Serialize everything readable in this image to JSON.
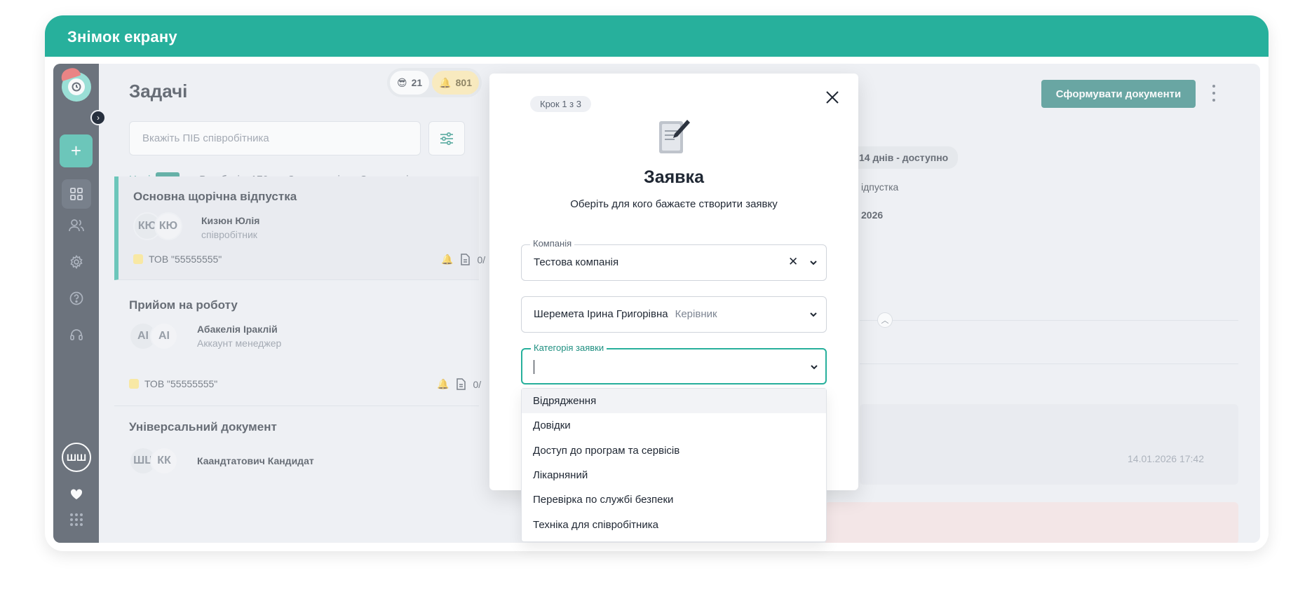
{
  "header": {
    "title": "Знімок екрану"
  },
  "sidebar": {
    "user_initials": "ШШ",
    "icons": [
      "plus-icon",
      "grid-icon",
      "users-icon",
      "gear-icon",
      "help-icon",
      "headset-icon",
      "heart-icon",
      "apps-grid-icon"
    ]
  },
  "tasks_panel": {
    "title": "Задачі",
    "counters": [
      {
        "emoji": "😎",
        "value": "21"
      },
      {
        "emoji": "🔔",
        "value": "801"
      }
    ],
    "search": {
      "placeholder": "Вкажіть ПІБ співробітника"
    },
    "tabs": [
      {
        "label": "Нові",
        "count": "340"
      },
      {
        "label": "В роботі",
        "count": "170"
      },
      {
        "label": "Завершені"
      },
      {
        "label": "Скасовані"
      }
    ],
    "tasks": [
      {
        "title": "Основна щорічна відпустка",
        "avatars": [
          "КЮ",
          "КЮ"
        ],
        "name": "Кизюн Юлія",
        "role": "співробітник",
        "company": "ТОВ \"55555555\"",
        "docs": "0/"
      },
      {
        "title": "Прийом на роботу",
        "avatars": [
          "АІ",
          "АІ"
        ],
        "name": "Абакелія Іраклій",
        "role": "Аккаунт менеджер",
        "company": "ТОВ \"55555555\"",
        "docs": "0/"
      },
      {
        "title": "Універсальний документ",
        "avatars": [
          "ШЦ",
          "КК"
        ],
        "name": "Каандтатович Кандидат"
      }
    ]
  },
  "right_panel": {
    "generate_button": "Сформувати документи",
    "chip": "14 днів - доступно",
    "line1": "ідпустка",
    "line2": "2026",
    "message_date": "14.01.2026  17:42"
  },
  "modal": {
    "step": "Крок 1 з 3",
    "title": "Заявка",
    "subtitle": "Оберіть для кого бажаєте створити заявку",
    "company_field": {
      "label": "Компанія",
      "value": "Тестова компанія"
    },
    "person_field": {
      "value": "Шеремета Ірина Григорівна",
      "hint": "Керівник"
    },
    "category_field": {
      "label": "Категорія заявки",
      "value": ""
    },
    "options": [
      "Відрядження",
      "Довідки",
      "Доступ до програм та сервісів",
      "Лікарняний",
      "Перевірка по службі безпеки",
      "Техніка для співробітника"
    ]
  },
  "colors": {
    "accent": "#27b09c",
    "sidebar": "#27303e",
    "button": "#237f78"
  }
}
